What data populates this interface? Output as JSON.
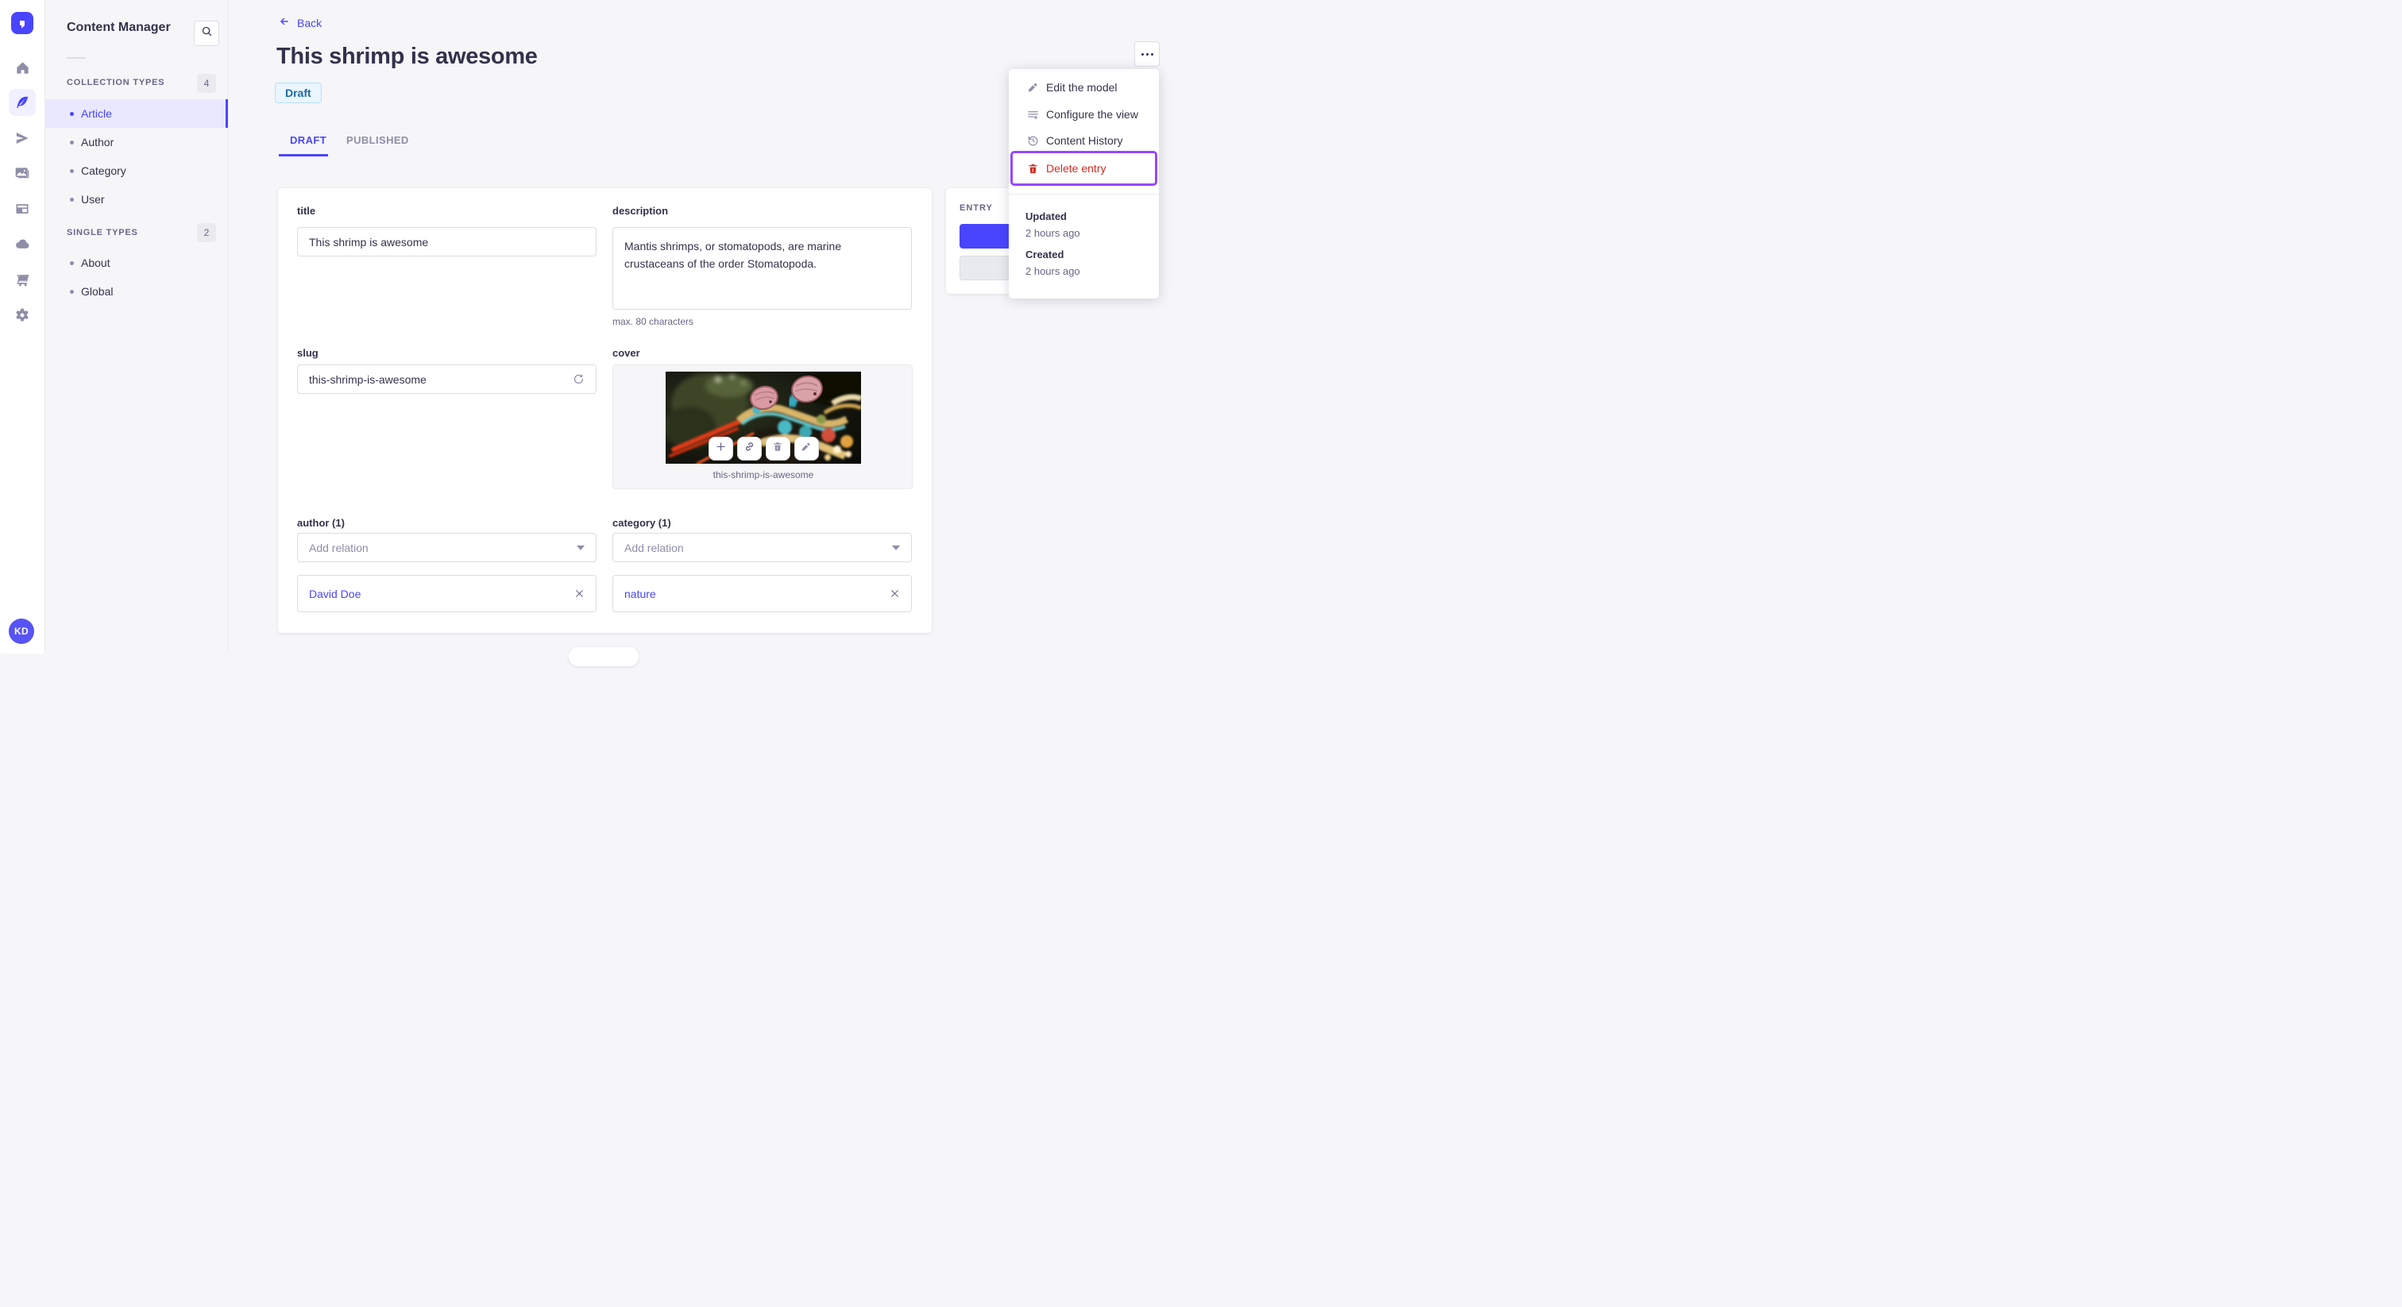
{
  "app": {
    "avatar_initials": "KD"
  },
  "subnav": {
    "title": "Content Manager",
    "sections": [
      {
        "label": "COLLECTION TYPES",
        "count": "4",
        "items": [
          {
            "label": "Article"
          },
          {
            "label": "Author"
          },
          {
            "label": "Category"
          },
          {
            "label": "User"
          }
        ]
      },
      {
        "label": "SINGLE TYPES",
        "count": "2",
        "items": [
          {
            "label": "About"
          },
          {
            "label": "Global"
          }
        ]
      }
    ]
  },
  "header": {
    "back_label": "Back",
    "title": "This shrimp is awesome",
    "status_badge": "Draft",
    "tabs": [
      {
        "label": "DRAFT"
      },
      {
        "label": "PUBLISHED"
      }
    ]
  },
  "form": {
    "title": {
      "label": "title",
      "value": "This shrimp is awesome"
    },
    "description": {
      "label": "description",
      "value": "Mantis shrimps, or stomatopods, are marine crustaceans of the order Stomatopoda.",
      "hint": "max. 80 characters"
    },
    "slug": {
      "label": "slug",
      "value": "this-shrimp-is-awesome"
    },
    "cover": {
      "label": "cover",
      "caption": "this-shrimp-is-awesome"
    },
    "author": {
      "label": "author (1)",
      "placeholder": "Add relation",
      "selected": "David Doe"
    },
    "category": {
      "label": "category (1)",
      "placeholder": "Add relation",
      "selected": "nature"
    }
  },
  "entry_panel": {
    "title": "ENTRY"
  },
  "context_menu": {
    "items": [
      {
        "label": "Edit the model"
      },
      {
        "label": "Configure the view"
      },
      {
        "label": "Content History"
      },
      {
        "label": "Delete entry"
      }
    ],
    "meta": [
      {
        "label": "Updated",
        "value": "2 hours ago"
      },
      {
        "label": "Created",
        "value": "2 hours ago"
      }
    ]
  },
  "colors": {
    "accent": "#4945ff",
    "danger": "#d02b20",
    "highlight": "#9747ff",
    "draft_bg": "#eaf5ff",
    "draft_text": "#1c6ca0"
  }
}
